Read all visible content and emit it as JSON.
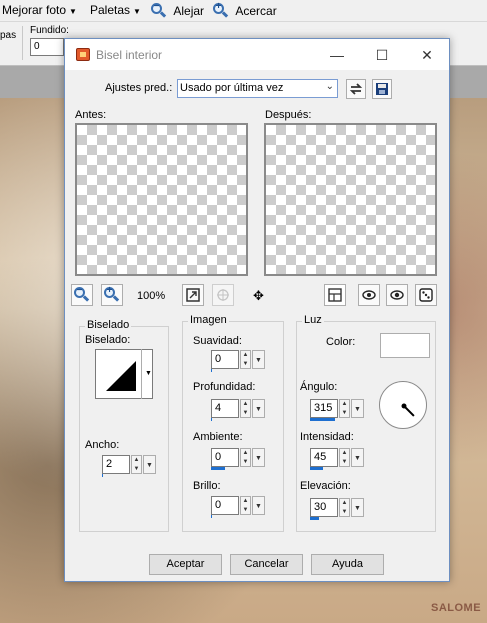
{
  "app": {
    "menu": [
      {
        "label": "Mejorar foto",
        "has_caret": true
      },
      {
        "label": "Paletas",
        "has_caret": true
      },
      {
        "label": "Alejar",
        "icon": "zoom-out-icon"
      },
      {
        "label": "Acercar",
        "icon": "zoom-in-icon"
      }
    ],
    "toolbar": {
      "partial_label": "pas",
      "fundido_label": "Fundido:",
      "fundido_value": "0"
    },
    "watermark": "SALOME"
  },
  "dialog": {
    "title": "Bisel interior",
    "presets_label": "Ajustes pred.:",
    "presets_value": "Usado por última vez",
    "before_label": "Antes:",
    "after_label": "Después:",
    "zoom": "100%",
    "bevel_group": {
      "title": "Biselado",
      "bevel_label": "Biselado:",
      "width_label": "Ancho:",
      "width_value": "2",
      "width_fraction": 0.02
    },
    "image_group": {
      "title": "Imagen",
      "fields": [
        {
          "label": "Suavidad:",
          "value": "0",
          "fraction": 0.0
        },
        {
          "label": "Profundidad:",
          "value": "4",
          "fraction": 0.04
        },
        {
          "label": "Ambiente:",
          "value": "0",
          "fraction": 0.5
        },
        {
          "label": "Brillo:",
          "value": "0",
          "fraction": 0.0
        }
      ]
    },
    "light_group": {
      "title": "Luz",
      "color_label": "Color:",
      "color_value": "#ffffff",
      "angle_label": "Ángulo:",
      "angle_value": "315",
      "angle_fraction": 0.875,
      "intensity_label": "Intensidad:",
      "intensity_value": "45",
      "intensity_fraction": 0.45,
      "elevation_label": "Elevación:",
      "elevation_value": "30",
      "elevation_fraction": 0.33
    },
    "buttons": {
      "ok": "Aceptar",
      "cancel": "Cancelar",
      "help": "Ayuda"
    }
  },
  "colors": {
    "accent": "#1e6fd0",
    "dialog_bg": "#f0f0f0"
  }
}
